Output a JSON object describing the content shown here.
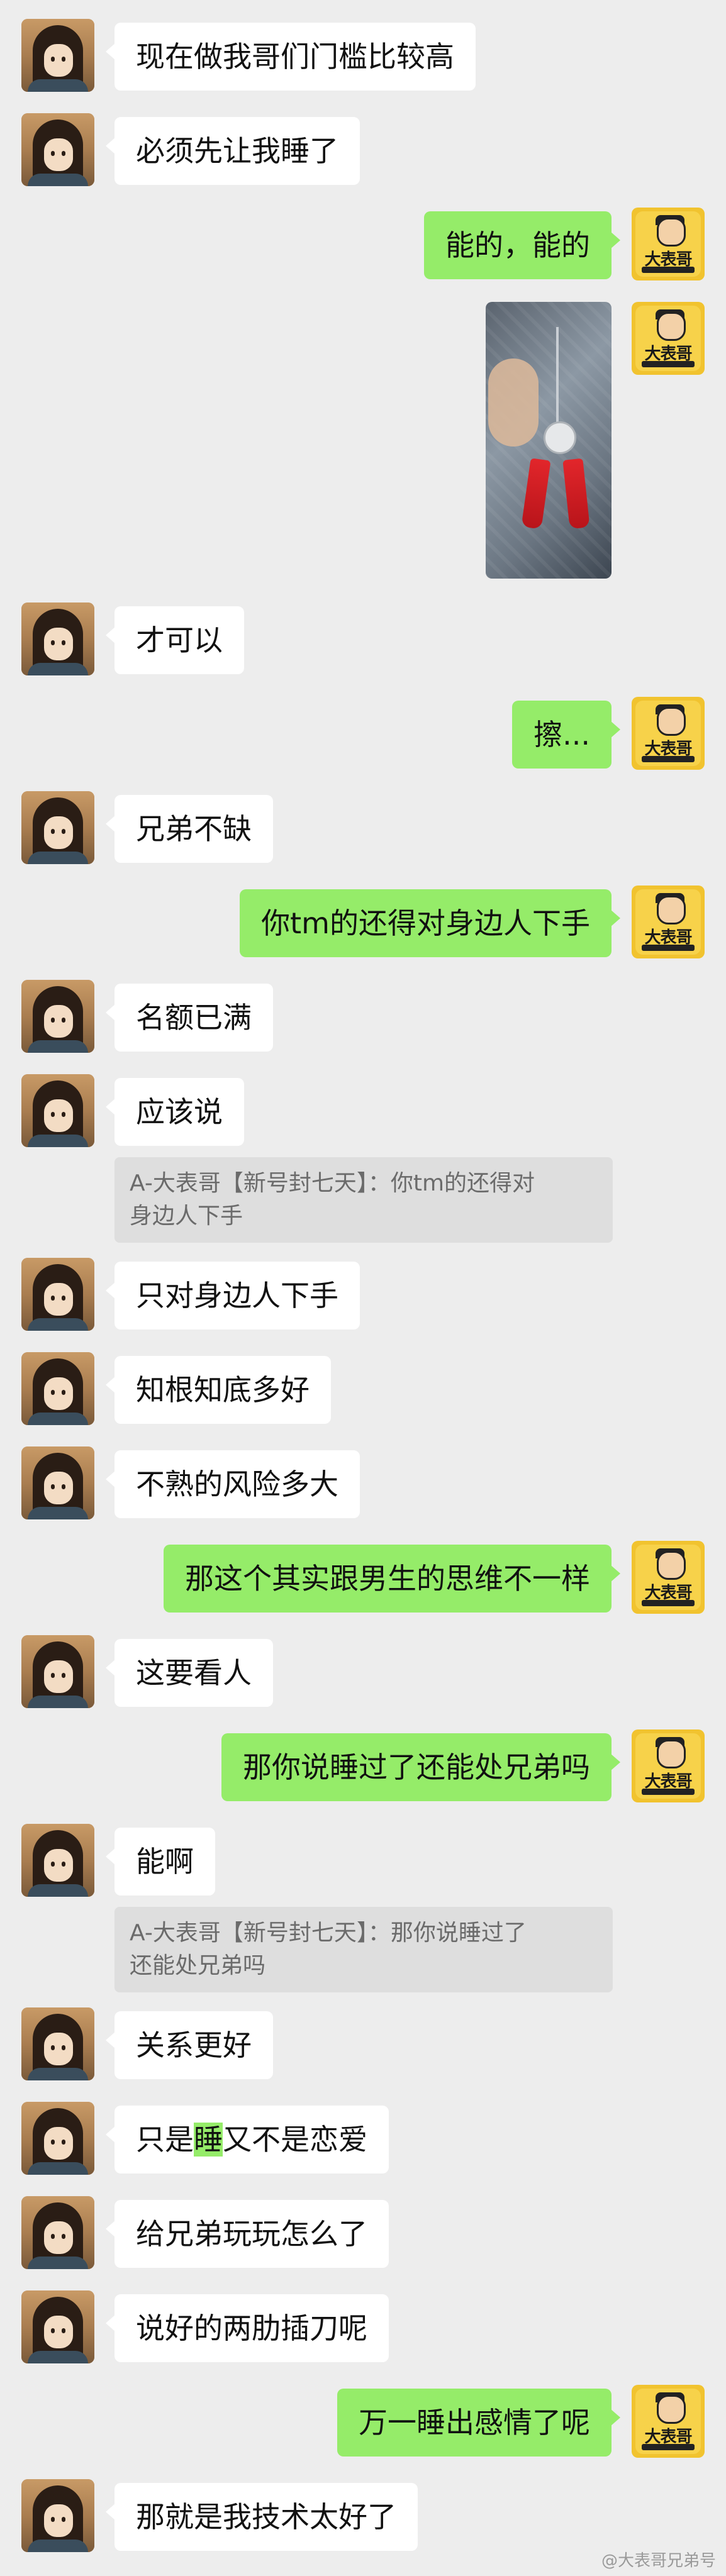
{
  "messages": [
    {
      "side": "left",
      "text": "现在做我哥们门槛比较高"
    },
    {
      "side": "left",
      "text": "必须先让我睡了"
    },
    {
      "side": "right",
      "text": "能的，能的"
    },
    {
      "side": "left",
      "text": "才可以"
    },
    {
      "side": "right",
      "text": "擦..."
    },
    {
      "side": "left",
      "text": "兄弟不缺"
    },
    {
      "side": "right",
      "text": "你tm的还得对身边人下手"
    },
    {
      "side": "left",
      "text": "名额已满"
    },
    {
      "side": "left",
      "text": "应该说"
    },
    {
      "quote": "A-大表哥【新号封七天】：你tm的还得对身边人下手"
    },
    {
      "side": "left",
      "text": "只对身边人下手"
    },
    {
      "side": "left",
      "text": "知根知底多好"
    },
    {
      "side": "left",
      "text": "不熟的风险多大"
    },
    {
      "side": "right",
      "text": "那这个其实跟男生的思维不一样"
    },
    {
      "side": "left",
      "text": "这要看人"
    },
    {
      "side": "right",
      "text": "那你说睡过了还能处兄弟吗"
    },
    {
      "side": "left",
      "text": "能啊"
    },
    {
      "quote": "A-大表哥【新号封七天】：那你说睡过了还能处兄弟吗"
    },
    {
      "side": "left",
      "text": "关系更好"
    },
    {
      "side": "left",
      "text_a": "只是",
      "text_hl": "睡",
      "text_b": "又不是恋爱"
    },
    {
      "side": "left",
      "text": "给兄弟玩玩怎么了"
    },
    {
      "side": "left",
      "text": "说好的两肋插刀呢"
    },
    {
      "side": "right",
      "text": "万一睡出感情了呢"
    },
    {
      "side": "left",
      "text": "那就是我技术太好了"
    }
  ],
  "quote1_line1": "A-大表哥【新号封七天】：你tm的还得对",
  "quote1_line2": "身边人下手",
  "quote2_line1": "A-大表哥【新号封七天】：那你说睡过了",
  "quote2_line2": "还能处兄弟吗",
  "avatar_text": "大表哥",
  "watermark": "@大表哥兄弟号",
  "colors": {
    "background": "#ededed",
    "sent_bubble": "#95ec69",
    "received_bubble": "#ffffff",
    "quote_bg": "#dedede"
  }
}
